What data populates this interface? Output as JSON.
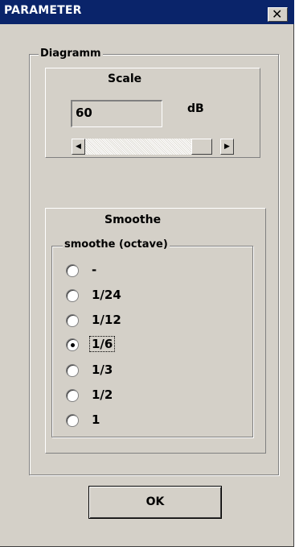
{
  "window": {
    "title": "PARAMETER",
    "close_glyph": "✕"
  },
  "diagramm": {
    "label": "Diagramm",
    "scale": {
      "label": "Scale",
      "value": "60",
      "unit": "dB",
      "left_arrow": "◀",
      "right_arrow": "▶"
    },
    "smoothe": {
      "label": "Smoothe",
      "group_label": "smoothe (octave)",
      "selected": "1/6",
      "options": [
        {
          "label": "-"
        },
        {
          "label": "1/24"
        },
        {
          "label": "1/12"
        },
        {
          "label": "1/6"
        },
        {
          "label": "1/3"
        },
        {
          "label": "1/2"
        },
        {
          "label": "1"
        }
      ]
    }
  },
  "buttons": {
    "ok": "OK"
  }
}
